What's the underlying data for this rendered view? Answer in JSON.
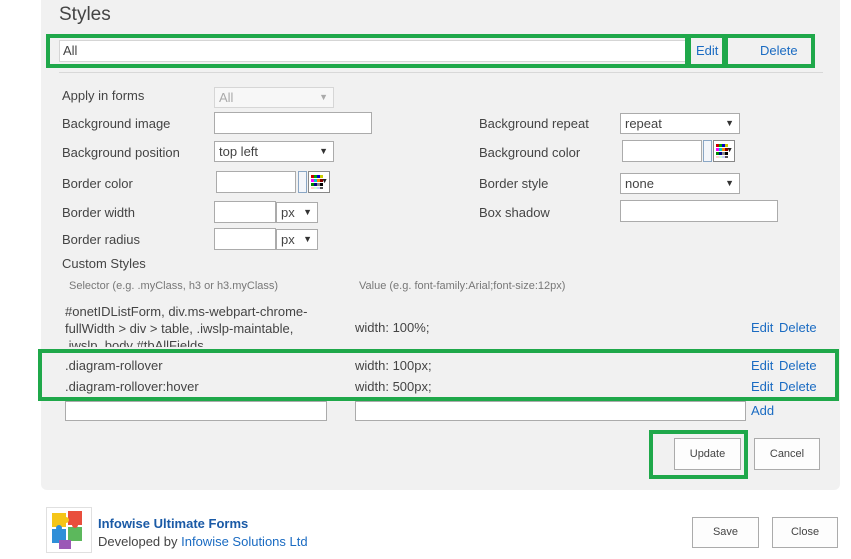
{
  "section": {
    "title": "Styles",
    "style_set": {
      "value": "All",
      "edit_label": "Edit",
      "delete_label": "Delete"
    }
  },
  "form": {
    "apply_in_forms": {
      "label": "Apply in forms",
      "value": "All"
    },
    "background_image": {
      "label": "Background image",
      "value": ""
    },
    "background_repeat": {
      "label": "Background repeat",
      "value": "repeat"
    },
    "background_position": {
      "label": "Background position",
      "value": "top left"
    },
    "background_color": {
      "label": "Background color",
      "value": ""
    },
    "border_color": {
      "label": "Border color",
      "value": ""
    },
    "border_style": {
      "label": "Border style",
      "value": "none"
    },
    "border_width": {
      "label": "Border width",
      "value": "",
      "unit": "px"
    },
    "box_shadow": {
      "label": "Box shadow",
      "value": ""
    },
    "border_radius": {
      "label": "Border radius",
      "value": "",
      "unit": "px"
    },
    "arrow_glyph": "▼"
  },
  "custom_styles": {
    "title": "Custom Styles",
    "selector_hint": "Selector (e.g. .myClass, h3 or h3.myClass)",
    "value_hint": "Value (e.g. font-family:Arial;font-size:12px)",
    "edit_label": "Edit",
    "delete_label": "Delete",
    "add_label": "Add",
    "rows": [
      {
        "selector_lines": [
          "#onetIDListForm, div.ms-webpart-chrome-",
          "fullWidth > div > table, .iwslp-maintable,",
          ".iwslp_body #tbAllFields"
        ],
        "value": "width: 100%;"
      },
      {
        "selector_lines": [
          ".diagram-rollover"
        ],
        "value": "width: 100px;"
      },
      {
        "selector_lines": [
          ".diagram-rollover:hover"
        ],
        "value": "width: 500px;"
      }
    ]
  },
  "actions": {
    "update_label": "Update",
    "cancel_label": "Cancel"
  },
  "footer": {
    "product_name": "Infowise Ultimate Forms",
    "developed_by": "Developed by",
    "company_link": "Infowise Solutions Ltd",
    "save_label": "Save",
    "close_label": "Close"
  },
  "colors": {
    "highlight": "#1fa84a",
    "link": "#1a6bc2",
    "panel": "#f1f1f1"
  }
}
